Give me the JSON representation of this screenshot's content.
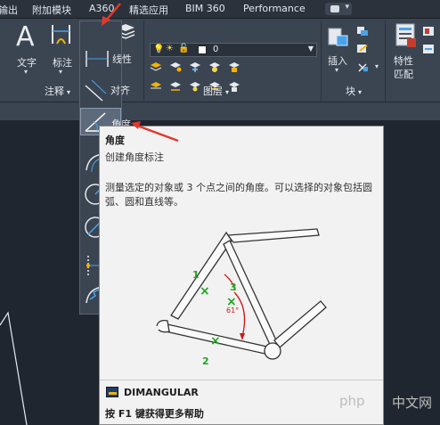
{
  "menu_tabs": [
    "输出",
    "附加模块",
    "A360",
    "精选应用",
    "BIM 360",
    "Performance"
  ],
  "ribbon": {
    "text_tool_label": "文字",
    "text_tool_letter": "A",
    "dim_tool_label": "标注",
    "linear_label": "线性",
    "annotation_panel_label": "注释",
    "layer_combo_value": "0",
    "layers_panel_label": "图层",
    "insert_label": "插入",
    "block_panel_label": "块",
    "match_label_line1": "特性",
    "match_label_line2": "匹配"
  },
  "dim_dropdown": {
    "items": [
      "对齐",
      "角度"
    ]
  },
  "tooltip": {
    "title": "角度",
    "subtitle": "创建角度标注",
    "description": "测量选定的对象或 3 个点之间的角度。可以选择的对象包括圆弧、圆和直线等。",
    "figure": {
      "point1": "1",
      "point2": "2",
      "point3": "3",
      "angle": "61°"
    },
    "command": "DIMANGULAR",
    "help": "按 F1 键获得更多帮助"
  },
  "watermark": {
    "text": "php",
    "number": "中文网"
  },
  "colors": {
    "accent_red": "#e0392b",
    "ribbon_bg": "#3b4451",
    "tooltip_bg": "#f2f2f2",
    "figure_green": "#1fa51f"
  }
}
